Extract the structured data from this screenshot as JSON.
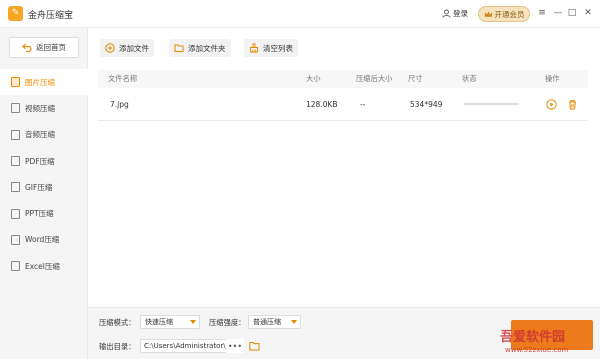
{
  "app": {
    "logo_glyph": "✎",
    "title": "金舟压缩宝",
    "login_label": "登录",
    "vip_label": "开通会员"
  },
  "window_controls": {
    "menu": "≡",
    "minimize": "—",
    "maximize": "□",
    "close": "✕"
  },
  "sidebar": {
    "back_label": "返回首页",
    "items": [
      {
        "label": "图片压缩",
        "active": true
      },
      {
        "label": "视频压缩",
        "active": false
      },
      {
        "label": "音频压缩",
        "active": false
      },
      {
        "label": "PDF压缩",
        "active": false
      },
      {
        "label": "GIF压缩",
        "active": false
      },
      {
        "label": "PPT压缩",
        "active": false
      },
      {
        "label": "Word压缩",
        "active": false
      },
      {
        "label": "Excel压缩",
        "active": false
      }
    ]
  },
  "toolbar": {
    "add_file": "添加文件",
    "add_folder": "添加文件夹",
    "clear_list": "清空列表"
  },
  "table": {
    "columns": [
      "文件名称",
      "大小",
      "压缩后大小",
      "尺寸",
      "状态",
      "操作"
    ],
    "rows": [
      {
        "name": "7.jpg",
        "size": "128.0KB",
        "compressed": "--",
        "dimensions": "534*949",
        "progress": 0
      }
    ]
  },
  "bottom": {
    "mode_label": "压缩模式：",
    "mode_value": "快速压缩",
    "strength_label": "压缩强度：",
    "strength_value": "普通压缩",
    "output_label": "输出目录：",
    "output_path": "C:\\Users\\Administrator\\D",
    "more_label": "•••"
  },
  "watermark": {
    "text": "吾爱软件园",
    "url": "www.52zxiue.com"
  },
  "colors": {
    "accent": "#f08a00",
    "start_button": "#ed7a1c",
    "vip_bg": "#f6e2bd"
  }
}
